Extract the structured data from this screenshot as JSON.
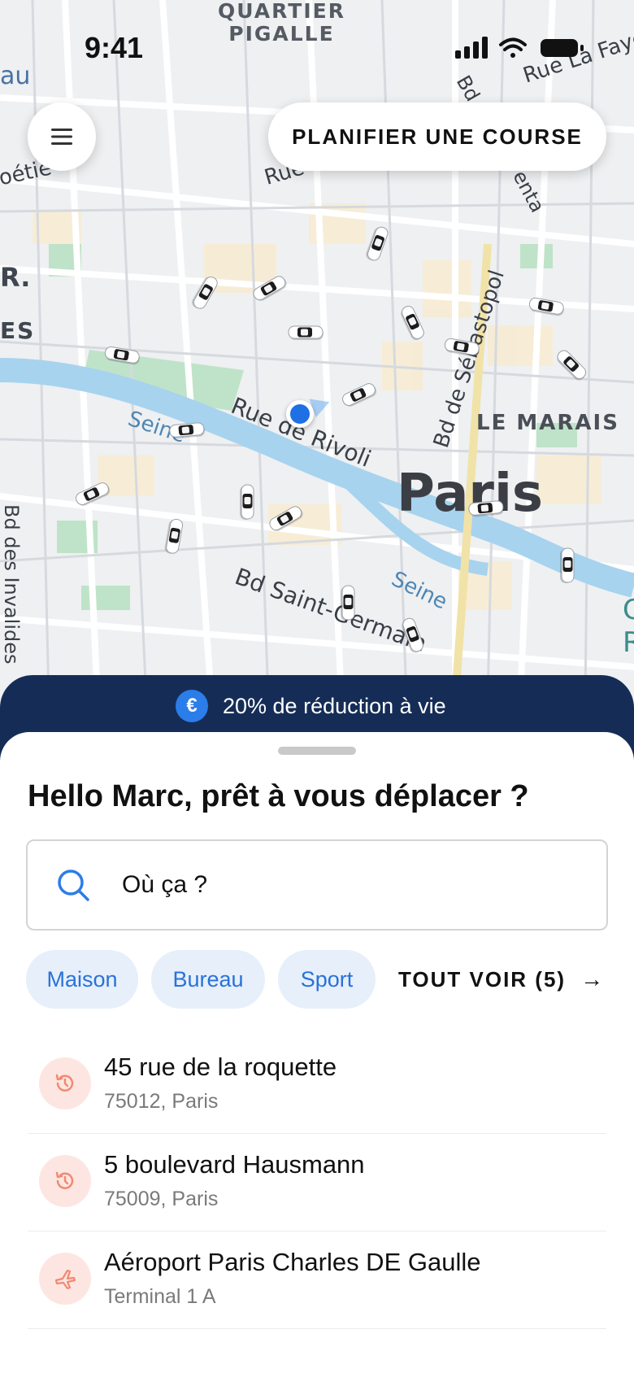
{
  "status_bar": {
    "time": "9:41"
  },
  "map": {
    "labels": {
      "quartier_pigalle": "QUARTIER\nPIGALLE",
      "paris": "Paris",
      "le_marais": "LE MARAIS",
      "rue_rivoli": "Rue de Rivoli",
      "bd_saint_germain": "Bd Saint-Germain",
      "bd_sebastopol": "Bd de Sébastopol",
      "seine_1": "Seine",
      "seine_2": "Seine",
      "rue_top": "Rue",
      "rue_la_fayette": "Rue La Faye",
      "bd_top": "Bd",
      "enta": "enta",
      "au": "au",
      "oetie": "oétie",
      "r": "R.",
      "es": "ES",
      "invalides": "Bd des Invalides",
      "right_edge": "C\nR"
    },
    "user_location_icon": "location-dot-icon",
    "car_icon": "car-icon"
  },
  "header": {
    "menu_icon": "hamburger-menu-icon",
    "plan_button": "PLANIFIER UNE COURSE"
  },
  "promo": {
    "icon": "euro-icon",
    "icon_glyph": "€",
    "text": "20% de réduction à vie"
  },
  "sheet": {
    "greeting": "Hello Marc, prêt à vous déplacer ?",
    "search": {
      "icon": "search-icon",
      "value": "Où ça ?"
    },
    "chips": [
      {
        "label": "Maison"
      },
      {
        "label": "Bureau"
      },
      {
        "label": "Sport"
      }
    ],
    "see_all": {
      "label": "TOUT VOIR (5)",
      "icon": "arrow-right-icon",
      "arrow": "→"
    },
    "recent_places": [
      {
        "icon": "history-icon",
        "title": "45 rue de la roquette",
        "subtitle": "75012, Paris"
      },
      {
        "icon": "history-icon",
        "title": "5 boulevard Hausmann",
        "subtitle": "75009, Paris"
      },
      {
        "icon": "airplane-icon",
        "title": "Aéroport Paris Charles DE Gaulle",
        "subtitle": "Terminal 1 A"
      }
    ]
  },
  "colors": {
    "promo_bg": "#152d56",
    "accent_blue": "#2b7de9",
    "chip_bg": "#e6effa",
    "chip_text": "#2a72d8",
    "recent_icon_bg": "#fde6e1",
    "recent_icon_fg": "#f08a72",
    "seine": "#a7d3ee",
    "park": "#bfe3c8"
  }
}
